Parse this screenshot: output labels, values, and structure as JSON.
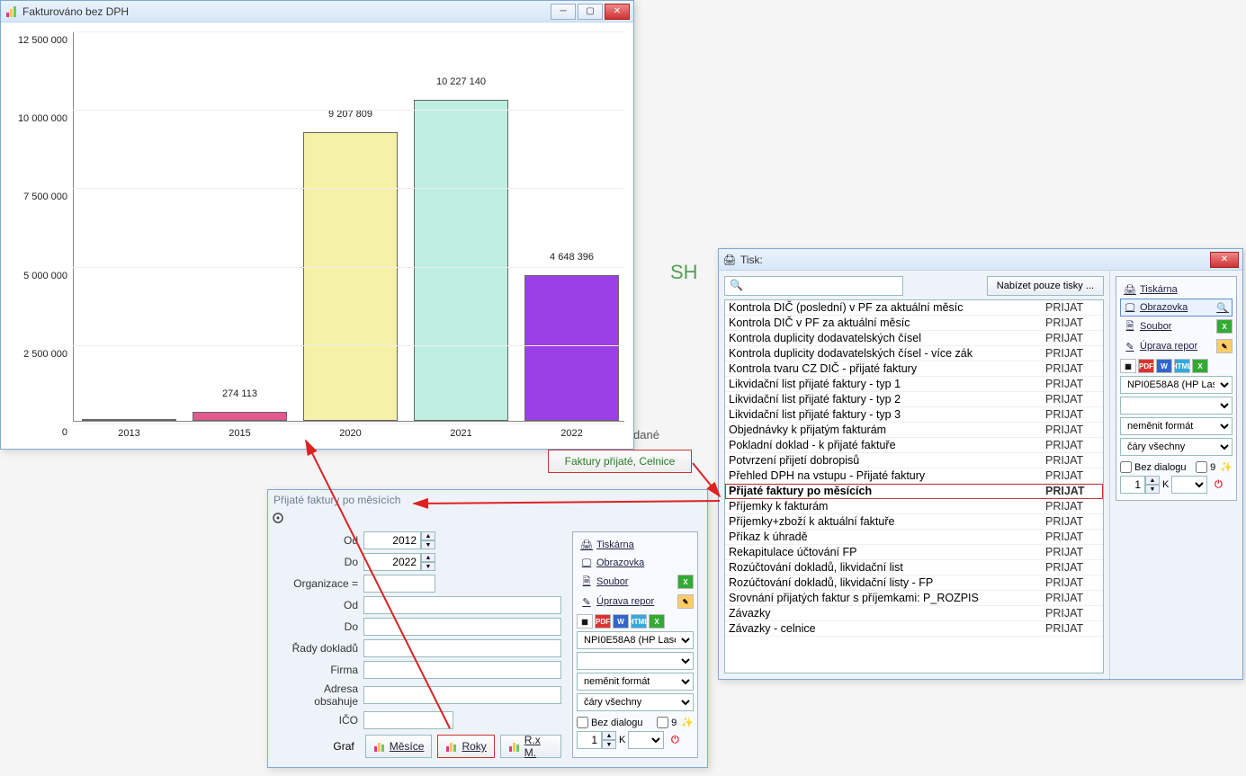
{
  "chart_window": {
    "title": "Fakturováno bez DPH"
  },
  "chart_data": {
    "type": "bar",
    "title": "Fakturováno bez DPH",
    "xlabel": "",
    "ylabel": "",
    "ylim": [
      0,
      12500000
    ],
    "yticks": [
      0,
      2500000,
      5000000,
      7500000,
      10000000,
      12500000
    ],
    "ytick_labels": [
      "0",
      "2 500 000",
      "5 000 000",
      "7 500 000",
      "10 000 000",
      "12 500 000"
    ],
    "categories": [
      "2013",
      "2015",
      "2020",
      "2021",
      "2022"
    ],
    "values": [
      0,
      274113,
      9207809,
      10227140,
      4648396
    ],
    "value_labels": [
      "",
      "274 113",
      "9 207 809",
      "10 227 140",
      "4 648 396"
    ],
    "colors": [
      "#e05a8f",
      "#e05a8f",
      "#f5f2a7",
      "#bdeee0",
      "#9b3fe6"
    ]
  },
  "stub_sh": "SH",
  "stub_vydane": "dané",
  "green_button": "Faktury přijaté, Celnice",
  "dialog": {
    "title": "Přijaté faktury po měsících",
    "labels": {
      "od": "Od",
      "do": "Do",
      "org": "Organizace =",
      "od2": "Od",
      "do2": "Do",
      "rady": "Řady dokladů",
      "firma": "Firma",
      "adresa": "Adresa obsahuje",
      "ico": "IČO",
      "graf": "Graf"
    },
    "values": {
      "od": "2012",
      "do": "2022"
    },
    "buttons": {
      "mesice": "Měsíce",
      "roky": "Roky",
      "rxm": "R.x M."
    }
  },
  "side_panel": {
    "tiskarna": "Tiskárna",
    "obrazovka": "Obrazovka",
    "soubor": "Soubor",
    "uprava": "Úprava repor",
    "printer_sel": "NPI0E58A8 (HP Lase",
    "format": "neměnit formát",
    "cary": "čáry všechny",
    "bez_dialogu": "Bez dialogu",
    "nine": "9",
    "copies": "1",
    "k": "K"
  },
  "tisk": {
    "title": "Tisk:",
    "search_placeholder": "",
    "nabidka": "Nabízet pouze tisky ...",
    "items": [
      {
        "name": "Kontrola DIČ (poslední) v PF za aktuální měsíc",
        "cat": "PRIJAT"
      },
      {
        "name": "Kontrola DIČ v PF za aktuální měsíc",
        "cat": "PRIJAT"
      },
      {
        "name": "Kontrola duplicity dodavatelských čísel",
        "cat": "PRIJAT"
      },
      {
        "name": "Kontrola duplicity dodavatelských čísel - více zák",
        "cat": "PRIJAT"
      },
      {
        "name": "Kontrola tvaru CZ DIČ - přijaté faktury",
        "cat": "PRIJAT"
      },
      {
        "name": "Likvidační list přijaté faktury - typ 1",
        "cat": "PRIJAT"
      },
      {
        "name": "Likvidační list přijaté faktury - typ 2",
        "cat": "PRIJAT"
      },
      {
        "name": "Likvidační list přijaté faktury - typ 3",
        "cat": "PRIJAT"
      },
      {
        "name": "Objednávky k přijatým fakturám",
        "cat": "PRIJAT"
      },
      {
        "name": "Pokladní doklad - k přijaté faktuře",
        "cat": "PRIJAT"
      },
      {
        "name": "Potvrzení přijetí dobropisů",
        "cat": "PRIJAT"
      },
      {
        "name": "Přehled DPH na vstupu - Přijaté faktury",
        "cat": "PRIJAT"
      },
      {
        "name": "Přijaté faktury po měsících",
        "cat": "PRIJAT",
        "hl": true
      },
      {
        "name": "Příjemky k fakturám",
        "cat": "PRIJAT"
      },
      {
        "name": "Příjemky+zboží k aktuální faktuře",
        "cat": "PRIJAT"
      },
      {
        "name": "Příkaz k úhradě",
        "cat": "PRIJAT"
      },
      {
        "name": "Rekapitulace účtování FP",
        "cat": "PRIJAT"
      },
      {
        "name": "Rozúčtování dokladů, likvidační list",
        "cat": "PRIJAT"
      },
      {
        "name": "Rozúčtování dokladů, likvidační listy - FP",
        "cat": "PRIJAT"
      },
      {
        "name": "Srovnání přijatých faktur s příjemkami: P_ROZPIS",
        "cat": "PRIJAT"
      },
      {
        "name": "Závazky",
        "cat": "PRIJAT"
      },
      {
        "name": "Závazky - celnice",
        "cat": "PRIJAT"
      }
    ]
  }
}
